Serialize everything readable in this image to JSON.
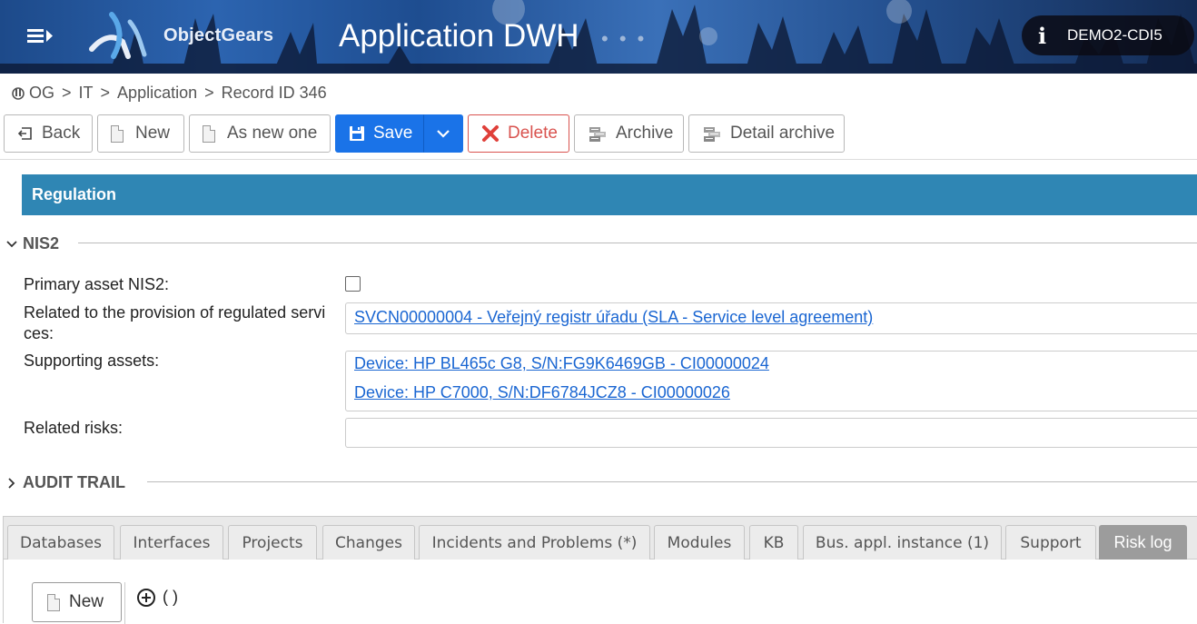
{
  "header": {
    "brand": "ObjectGears",
    "title": "Application DWH",
    "dots": "• • •",
    "info_icon": "i",
    "user": "DEMO2-CDI5"
  },
  "breadcrumb": {
    "icon": "ObjectGears-home-icon",
    "items": [
      "OG",
      "IT",
      "Application",
      "Record ID 346"
    ],
    "separator": ">"
  },
  "toolbar": {
    "back": "Back",
    "new": "New",
    "as_new_one": "As new one",
    "save": "Save",
    "delete": "Delete",
    "archive": "Archive",
    "detail_archive": "Detail archive"
  },
  "section": {
    "title": "Regulation"
  },
  "nis2": {
    "title": "NIS2",
    "primary_asset_label": "Primary asset NIS2:",
    "primary_asset_checked": false,
    "regulated_services_label_1": "Related to the provision of regulated servi",
    "regulated_services_label_2": "ces:",
    "regulated_services_link": "SVCN00000004 - Veřejný registr úřadu (SLA - Service level agreement)",
    "supporting_assets_label": "Supporting assets:",
    "supporting_assets": [
      "Device: HP BL465c G8, S/N:FG9K6469GB - CI00000024",
      "Device: HP C7000, S/N:DF6784JCZ8 - CI00000026"
    ],
    "related_risks_label": "Related risks:",
    "related_risks_value": ""
  },
  "audit": {
    "title": "AUDIT TRAIL"
  },
  "tabs": [
    {
      "label": "Databases"
    },
    {
      "label": "Interfaces"
    },
    {
      "label": "Projects"
    },
    {
      "label": "Changes"
    },
    {
      "label": "Incidents and Problems (*)"
    },
    {
      "label": "Modules"
    },
    {
      "label": "KB"
    },
    {
      "label": "Bus. appl. instance (1)"
    },
    {
      "label": "Support"
    },
    {
      "label": "Risk log"
    }
  ],
  "active_tab": "Risk log",
  "tab_panel": {
    "new": "New",
    "expander_text": "( )"
  },
  "colors": {
    "section_bar": "#2f86b4",
    "save": "#1a73e8",
    "delete": "#d9534f",
    "link": "#1a66d2",
    "active_tab": "#9c9c9c"
  }
}
